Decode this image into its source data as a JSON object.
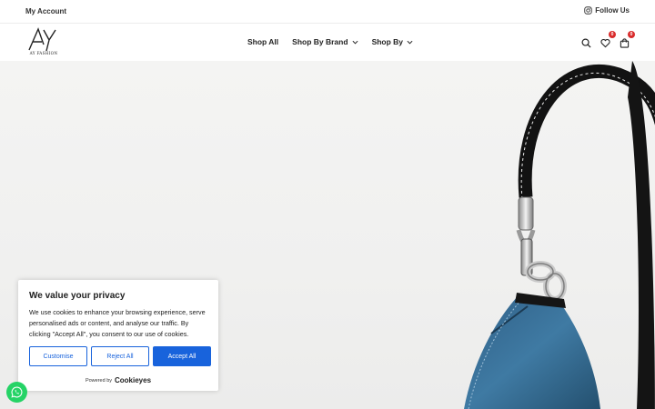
{
  "topbar": {
    "account_label": "My Account",
    "follow_label": "Follow Us"
  },
  "logo": {
    "monogram": "AY",
    "wordmark": "AY FASHION"
  },
  "nav": {
    "items": [
      {
        "label": "Shop All",
        "has_dropdown": false
      },
      {
        "label": "Shop By Brand",
        "has_dropdown": true
      },
      {
        "label": "Shop By",
        "has_dropdown": true
      }
    ]
  },
  "header_icons": {
    "search_icon": "search-icon",
    "wishlist_count": "0",
    "cart_count": "0"
  },
  "hero": {
    "image_subject": "denim shoulder bag with black leather strap and silver chain"
  },
  "cookie": {
    "title": "We value your privacy",
    "body": "We use cookies to enhance your browsing experience, serve personalised ads or content, and analyse our traffic. By clicking \"Accept All\", you consent to our use of cookies.",
    "customise_label": "Customise",
    "reject_label": "Reject All",
    "accept_label": "Accept All",
    "powered_by": "Powered by",
    "powered_brand": "Cookieyes"
  },
  "colors": {
    "accent": "#1863dc",
    "badge": "#d92c2c",
    "whatsapp": "#25d366"
  }
}
